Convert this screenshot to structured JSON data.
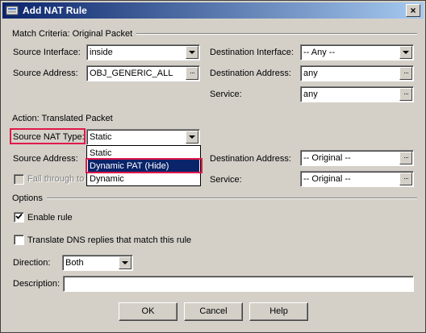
{
  "window": {
    "title": "Add NAT Rule",
    "close_label": "×"
  },
  "match": {
    "section_title": "Match Criteria: Original Packet",
    "source_interface": {
      "label": "Source Interface:",
      "value": "inside"
    },
    "source_address": {
      "label": "Source Address:",
      "value": "OBJ_GENERIC_ALL"
    },
    "destination_interface": {
      "label": "Destination Interface:",
      "value": "-- Any --"
    },
    "destination_address": {
      "label": "Destination Address:",
      "value": "any"
    },
    "service": {
      "label": "Service:",
      "value": "any"
    }
  },
  "action": {
    "section_title": "Action: Translated Packet",
    "source_nat_type": {
      "label": "Source NAT Type:",
      "value": "Static"
    },
    "source_address": {
      "label": "Source Address:"
    },
    "fall_through": {
      "label": "Fall through to"
    },
    "destination_address": {
      "label": "Destination Address:",
      "value": "-- Original --"
    },
    "service": {
      "label": "Service:",
      "value": "-- Original --"
    },
    "nat_type_options": [
      "Static",
      "Dynamic PAT (Hide)",
      "Dynamic"
    ],
    "selected_option": "Dynamic PAT (Hide)"
  },
  "options": {
    "section_title": "Options",
    "enable_rule": {
      "label": "Enable rule",
      "checked": true
    },
    "translate_dns": {
      "label": "Translate DNS replies that match this rule",
      "checked": false
    },
    "direction": {
      "label": "Direction:",
      "value": "Both"
    },
    "description": {
      "label": "Description:",
      "value": ""
    }
  },
  "buttons": {
    "ok": "OK",
    "cancel": "Cancel",
    "help": "Help"
  },
  "icons": {
    "app": "asdm-window-icon",
    "close": "close-icon",
    "dropdown": "chevron-down-icon",
    "browse": "ellipsis-browse-icon",
    "check": "checkmark-icon"
  },
  "colors": {
    "title_bar_start": "#0a246a",
    "title_bar_end": "#a6caf0",
    "selection": "#0a246a",
    "highlight_outline": "#e0194b",
    "dialog_bg": "#d4d0c8"
  }
}
